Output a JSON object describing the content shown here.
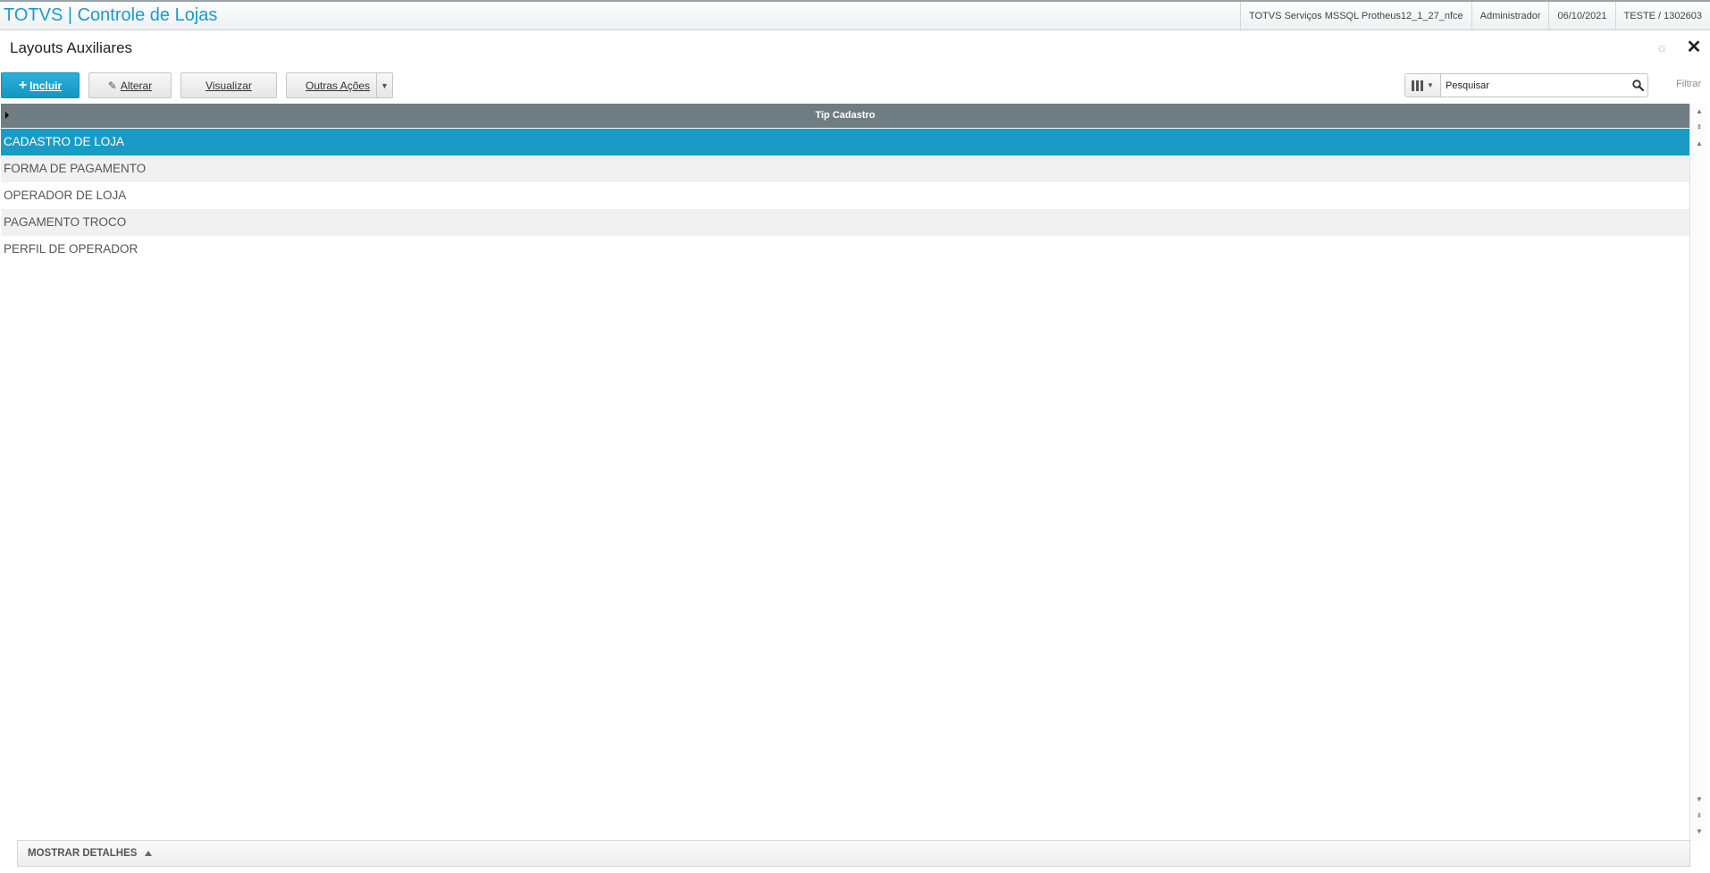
{
  "header": {
    "app_title": "TOTVS | Controle de Lojas",
    "environment": "TOTVS Serviços MSSQL Protheus12_1_27_nfce",
    "user": "Administrador",
    "date": "06/10/2021",
    "company": "TESTE / 1302603"
  },
  "page": {
    "title": "Layouts Auxiliares"
  },
  "toolbar": {
    "incluir_label": "Incluir",
    "alterar_label": "Alterar",
    "visualizar_label": "Visualizar",
    "outras_label": "Outras Ações",
    "search_placeholder": "Pesquisar",
    "filtrar_label": "Filtrar"
  },
  "grid": {
    "columns": [
      "Tip Cadastro"
    ],
    "rows": [
      "CADASTRO DE LOJA",
      "FORMA DE PAGAMENTO",
      "OPERADOR DE LOJA",
      "PAGAMENTO TROCO",
      "PERFIL DE OPERADOR"
    ],
    "selected_index": 0
  },
  "footer": {
    "details_label": "MOSTRAR DETALHES"
  },
  "colors": {
    "accent": "#1a9bc6",
    "header_bg": "#6f7d83"
  }
}
